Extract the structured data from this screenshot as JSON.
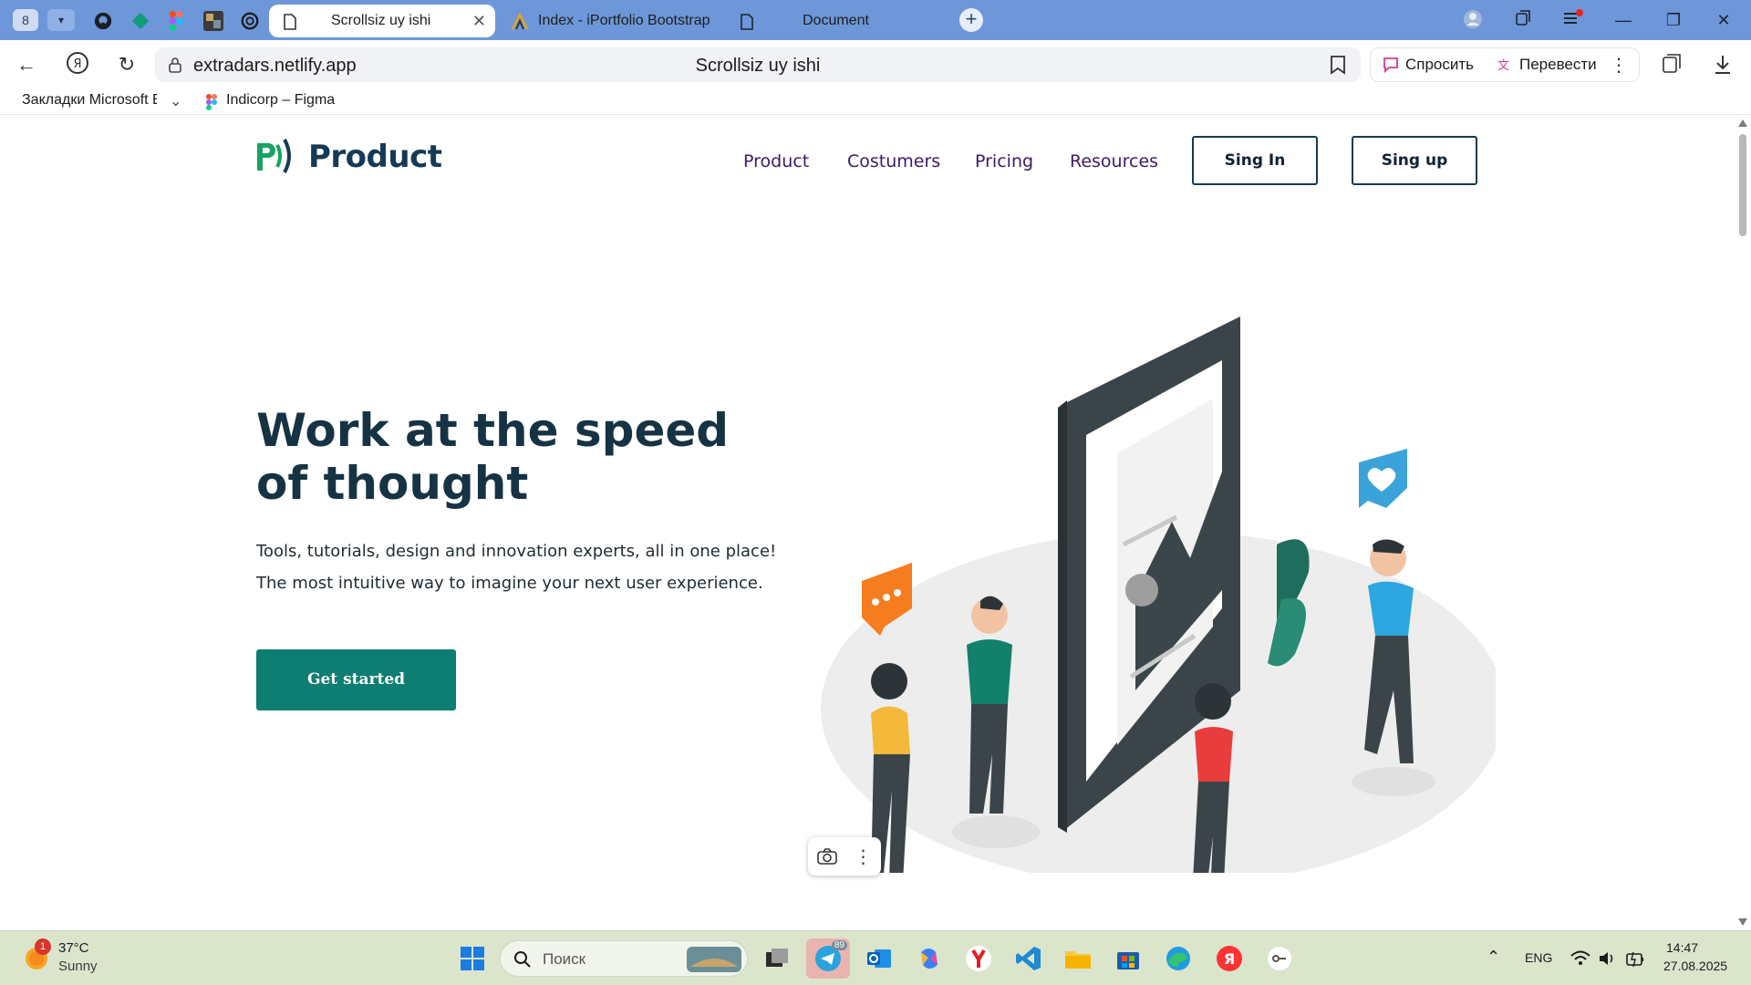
{
  "browser": {
    "tab_group_count": "8",
    "tabs": [
      {
        "title": "Scrollsiz uy ishi"
      },
      {
        "title": "Index - iPortfolio Bootstrap"
      },
      {
        "title": "Document"
      }
    ],
    "url": "extradars.netlify.app",
    "page_title": "Scrollsiz uy ishi",
    "assistant": {
      "ask": "Спросить",
      "translate": "Перевести"
    },
    "bookmarks": [
      {
        "label": "Закладки Microsoft Edge"
      },
      {
        "label": "Indicorp – Figma"
      }
    ]
  },
  "site": {
    "logo_text": "Product",
    "nav": [
      "Product",
      "Costumers",
      "Pricing",
      "Resources"
    ],
    "sign_in": "Sing In",
    "sign_up": "Sing up",
    "hero_title": "Work at the speed of thought",
    "hero_subtitle": "Tools, tutorials, design and innovation experts, all in one place! The most intuitive way to imagine your next user experience.",
    "cta": "Get started"
  },
  "taskbar": {
    "weather": {
      "temp": "37°C",
      "desc": "Sunny",
      "badge": "1"
    },
    "search_placeholder": "Поиск",
    "telegram_badge": "89",
    "lang": "ENG",
    "time": "14:47",
    "date": "27.08.2025"
  },
  "colors": {
    "tabstrip": "#6d97d9",
    "brand_green": "#0e7d72",
    "nav_purple": "#3b1a66",
    "heading": "#163344"
  }
}
